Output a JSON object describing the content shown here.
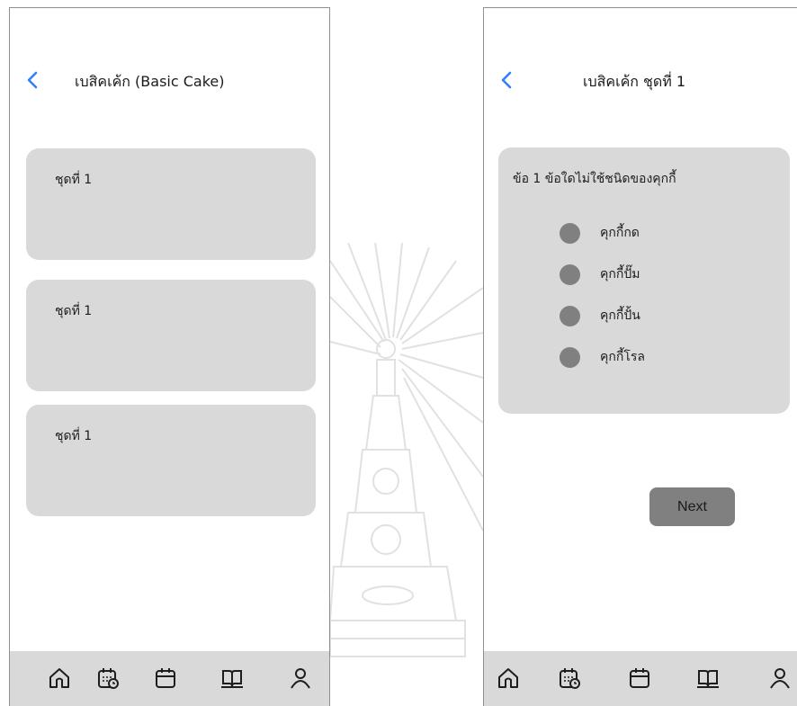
{
  "colors": {
    "accent": "#2f7fff",
    "card": "#d9d9d9",
    "radio": "#808080",
    "button": "#808080",
    "nav_bar": "#d9d9d9"
  },
  "left_screen": {
    "header": {
      "back_icon": "chevron-left-icon",
      "title": "เบสิคเค้ก (Basic Cake)"
    },
    "sets": [
      {
        "label": "ชุดที่ 1"
      },
      {
        "label": "ชุดที่ 1"
      },
      {
        "label": "ชุดที่ 1"
      }
    ],
    "nav": [
      "home-icon",
      "calendar-clock-icon",
      "calendar-icon",
      "book-icon",
      "user-icon"
    ]
  },
  "right_screen": {
    "header": {
      "back_icon": "chevron-left-icon",
      "title": "เบสิคเค้ก  ชุดที่ 1"
    },
    "question": "ข้อ 1 ข้อใดไม่ใช้ชนิดของคุกกี้",
    "options": [
      {
        "label": "คุกกี้กด"
      },
      {
        "label": "คุกกี้ปั๊ม"
      },
      {
        "label": "คุกกี้ปั้น"
      },
      {
        "label": "คุกกี้โรล"
      }
    ],
    "next_label": "Next",
    "nav": [
      "home-icon",
      "calendar-clock-icon",
      "calendar-icon",
      "book-icon",
      "user-icon"
    ]
  }
}
